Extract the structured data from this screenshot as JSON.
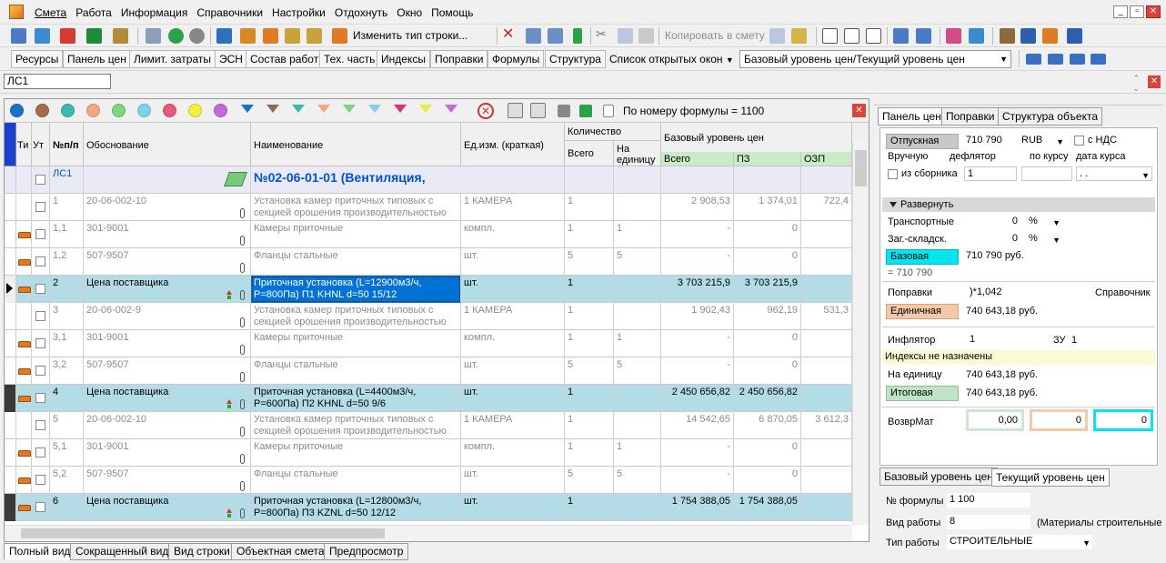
{
  "menu": [
    "Смета",
    "Работа",
    "Информация",
    "Справочники",
    "Настройки",
    "Отдохнуть",
    "Окно",
    "Помощь"
  ],
  "toolbar1": {
    "change_row_type": "Изменить тип строки...",
    "copy_to_estimate": "Копировать в смету"
  },
  "toolbar2": {
    "tabs": [
      "Ресурсы",
      "Панель цен",
      "Лимит. затраты",
      "ЭСН",
      "Состав работ",
      "Тех. часть",
      "Индексы",
      "Поправки",
      "Формулы",
      "Структура"
    ],
    "open_windows_label": "Список открытых окон",
    "price_level_select": "Базовый уровень цен/Текущий уровень цен"
  },
  "address": "ЛС1",
  "colors": {
    "accent_blue": "#0051d2",
    "highlight_row": "#b3dce6",
    "selected_cell": "#0072d6",
    "base_badge": "#00e5f0",
    "unit_badge": "#f3c9aa",
    "total_badge": "#bfe3c4",
    "ls_row": "#eaeaf7"
  },
  "filter_dots": [
    "#1a72c8",
    "#a66a4c",
    "#3cb8b0",
    "#f4a682",
    "#7dd67b",
    "#7dd0ee",
    "#e55a7e",
    "#f4ef3c",
    "#c26ad9"
  ],
  "funnels": [
    "#1a72c8",
    "#8c6a5a",
    "#3cb8b0",
    "#f4a682",
    "#7dd67b",
    "#7dd0ee",
    "#d1357b",
    "#eeea3c",
    "#c26ad9"
  ],
  "formula_info": "По номеру формулы = 1100",
  "columns": {
    "ti": "Ти",
    "ut": "Ут",
    "num": "№п/п",
    "basis": "Обоснование",
    "name": "Наименование",
    "unit": "Ед.изм. (краткая)",
    "qty": "Количество",
    "qty_total": "Всего",
    "qty_per": "На единицу",
    "base": "Базовый уровень цен",
    "base_total": "Всего",
    "pz": "ПЗ",
    "ozp": "ОЗП"
  },
  "rows": [
    {
      "kind": "ls",
      "num": "ЛС1",
      "name": "№02-06-01-01 (Вентиляция,"
    },
    {
      "kind": "grey",
      "brick": false,
      "num": "1",
      "basis": "20-06-002-10",
      "name": "Установка камер приточных типовых с секцией орошения производительностью",
      "unit": "1 КАМЕРА",
      "qty": "1",
      "per": "",
      "total": "2 908,53",
      "pz": "1 374,01",
      "ozp": "722,4"
    },
    {
      "kind": "grey",
      "brick": true,
      "num": "1,1",
      "basis": "301-9001",
      "name": "Камеры приточные",
      "unit": "компл.",
      "qty": "1",
      "per": "1",
      "total": "-",
      "pz": "0",
      "ozp": ""
    },
    {
      "kind": "grey",
      "brick": true,
      "num": "1,2",
      "basis": "507-9507",
      "name": "Фланцы стальные",
      "unit": "шт.",
      "qty": "5",
      "per": "5",
      "total": "-",
      "pz": "0",
      "ozp": ""
    },
    {
      "kind": "hl",
      "brick": true,
      "sel": true,
      "arrow": true,
      "num": "2",
      "basis": "Цена поставщика",
      "name": "Приточная установка (L=12900м3/ч, P=800Па) П1 KHNL d=50 15/12",
      "unit": "шт.",
      "qty": "1",
      "per": "",
      "total": "3 703 215,9",
      "pz": "3 703 215,9",
      "ozp": ""
    },
    {
      "kind": "grey",
      "brick": false,
      "num": "3",
      "basis": "20-06-002-9",
      "name": "Установка камер приточных типовых с секцией орошения производительностью",
      "unit": "1 КАМЕРА",
      "qty": "1",
      "per": "",
      "total": "1 902,43",
      "pz": "962,19",
      "ozp": "531,3"
    },
    {
      "kind": "grey",
      "brick": true,
      "num": "3,1",
      "basis": "301-9001",
      "name": "Камеры приточные",
      "unit": "компл.",
      "qty": "1",
      "per": "1",
      "total": "-",
      "pz": "0",
      "ozp": ""
    },
    {
      "kind": "grey",
      "brick": true,
      "num": "3,2",
      "basis": "507-9507",
      "name": "Фланцы стальные",
      "unit": "шт.",
      "qty": "5",
      "per": "5",
      "total": "-",
      "pz": "0",
      "ozp": ""
    },
    {
      "kind": "hl",
      "brick": true,
      "mark": true,
      "num": "4",
      "basis": "Цена поставщика",
      "name": "Приточная установка (L=4400м3/ч, P=600Па) П2 KHNL d=50 9/6",
      "unit": "шт.",
      "qty": "1",
      "per": "",
      "total": "2 450 656,82",
      "pz": "2 450 656,82",
      "ozp": ""
    },
    {
      "kind": "grey",
      "brick": false,
      "num": "5",
      "basis": "20-06-002-10",
      "name": "Установка камер приточных типовых с секцией орошения производительностью",
      "unit": "1 КАМЕРА",
      "qty": "1",
      "per": "",
      "total": "14 542,65",
      "pz": "6 870,05",
      "ozp": "3 612,3"
    },
    {
      "kind": "grey",
      "brick": true,
      "num": "5,1",
      "basis": "301-9001",
      "name": "Камеры приточные",
      "unit": "компл.",
      "qty": "1",
      "per": "1",
      "total": "-",
      "pz": "0",
      "ozp": ""
    },
    {
      "kind": "grey",
      "brick": true,
      "num": "5,2",
      "basis": "507-9507",
      "name": "Фланцы стальные",
      "unit": "шт.",
      "qty": "5",
      "per": "5",
      "total": "-",
      "pz": "0",
      "ozp": ""
    },
    {
      "kind": "hl",
      "brick": true,
      "mark": true,
      "num": "6",
      "basis": "Цена поставщика",
      "name": "Приточная установка (L=12800м3/ч, P=800Па) П3 KZNL d=50 12/12",
      "unit": "шт.",
      "qty": "1",
      "per": "",
      "total": "1 754 388,05",
      "pz": "1 754 388,05",
      "ozp": ""
    }
  ],
  "bottom_tabs": [
    "Полный вид",
    "Сокращенный вид",
    "Вид строки",
    "Объектная смета",
    "Предпросмотр"
  ],
  "rpanel": {
    "tabs": [
      "Панель цен",
      "Поправки",
      "Структура объекта"
    ],
    "otpusknaya_label": "Отпускная",
    "otpusknaya_value": "710 790",
    "currency": "RUB",
    "nds_label": "с НДС",
    "manual_label": "Вручную",
    "deflator_label": "дефлятор",
    "by_rate_label": "по курсу",
    "rate_date_label": "дата курса",
    "from_collection_label": "из сборника",
    "collection_value": "1",
    "date_value": ". .",
    "expand_label": "Развернуть",
    "transport_label": "Транспортные",
    "transport_value": "0",
    "storage_label": "Заг.-складск.",
    "storage_value": "0",
    "percent": "%",
    "base_label": "Базовая",
    "base_value": "710 790 руб.",
    "base_eq": "= 710 790",
    "corrections_label": "Поправки",
    "corrections_value": ")*1,042",
    "reference_label": "Справочник",
    "unit_label": "Единичная",
    "unit_value": "740 643,18 руб.",
    "inflator_label": "Инфлятор",
    "inflator_value": "1",
    "zu_label": "ЗУ",
    "zu_value": "1",
    "indexes_note": "Индексы не назначены",
    "per_unit_label": "На единицу",
    "per_unit_value": "740 643,18 руб.",
    "total_label": "Итоговая",
    "total_value": "740 643,18 руб.",
    "vozvrmat_label": "ВозврМат",
    "vozvr_values": [
      "0,00",
      "0",
      "0"
    ],
    "level_tabs": [
      "Базовый уровень цен",
      "Текущий уровень цен"
    ],
    "formula_no_label": "№ формулы",
    "formula_no_value": "1 100",
    "work_type_label": "Вид работы",
    "work_type_value": "8",
    "work_type_desc": "(Материалы строительные",
    "work_kind_label": "Тип работы",
    "work_kind_value": "СТРОИТЕЛЬНЫЕ"
  }
}
